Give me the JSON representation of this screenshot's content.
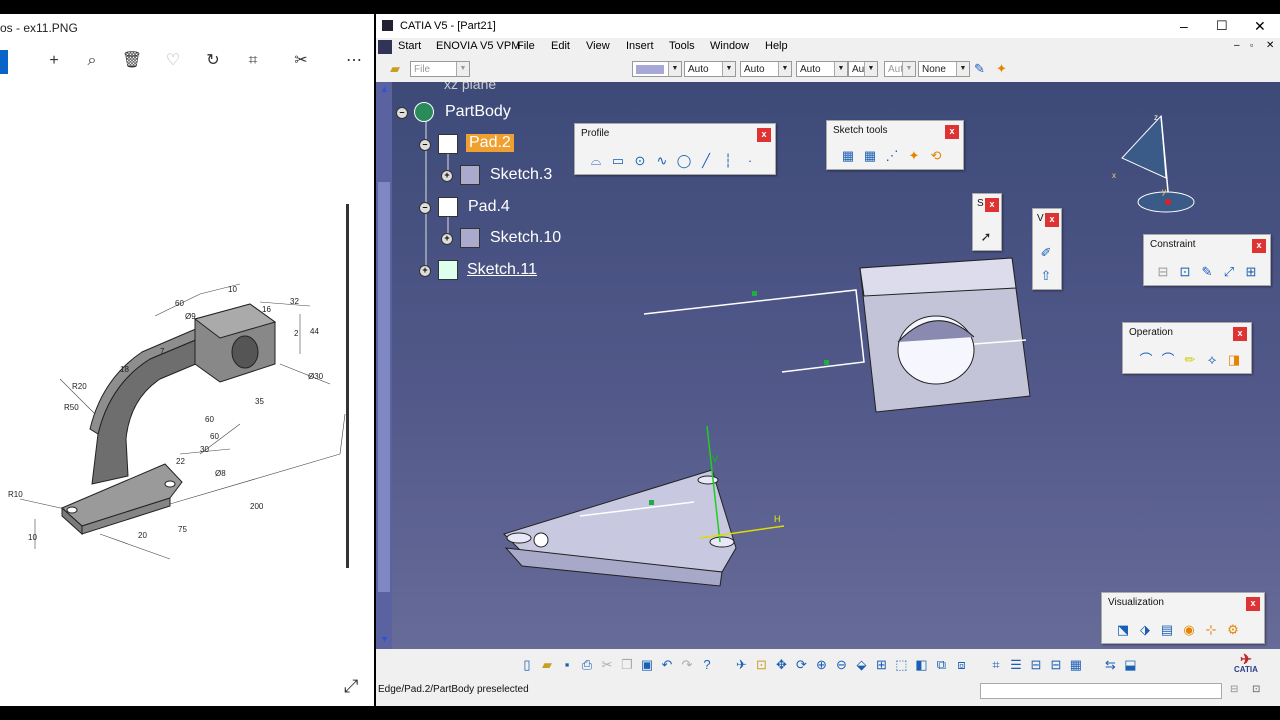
{
  "photos": {
    "title": "os - ex11.PNG",
    "toolbar": [
      {
        "name": "add-icon",
        "glyph": "+"
      },
      {
        "name": "zoom-icon",
        "glyph": "🔍"
      },
      {
        "name": "delete-icon",
        "glyph": "🗑"
      },
      {
        "name": "heart-icon",
        "glyph": "♡"
      },
      {
        "name": "rotate-icon",
        "glyph": "↻"
      },
      {
        "name": "crop-icon",
        "glyph": "⌗"
      },
      {
        "name": "edit-icon",
        "glyph": "✎"
      },
      {
        "name": "more-icon",
        "glyph": "⋯"
      }
    ],
    "drawing_labels": [
      "60",
      "Ø9",
      "10",
      "16",
      "32",
      "2",
      "44",
      "7",
      "Ø30",
      "R20",
      "18",
      "R50",
      "35",
      "60",
      "30",
      "22",
      "Ø8",
      "R10",
      "60",
      "200",
      "75",
      "20",
      "10"
    ]
  },
  "catia": {
    "title": "CATIA V5 - [Part21]",
    "menu": [
      "Start",
      "ENOVIA V5 VPM",
      "File",
      "Edit",
      "View",
      "Insert",
      "Tools",
      "Window",
      "Help"
    ],
    "toolbar_combos": [
      "File",
      "",
      "Auto",
      "Auto",
      "Auto",
      "Aut",
      "Aut",
      "None"
    ],
    "tree": {
      "partially_hidden": "xz plane",
      "items": [
        {
          "label": "PartBody",
          "selected": false
        },
        {
          "label": "Pad.2",
          "selected": true
        },
        {
          "label": "Sketch.3",
          "selected": false
        },
        {
          "label": "Pad.4",
          "selected": false
        },
        {
          "label": "Sketch.10",
          "selected": false
        },
        {
          "label": "Sketch.11",
          "selected": false
        }
      ]
    },
    "panels": {
      "profile": "Profile",
      "sketch_tools": "Sketch tools",
      "s_small": "S",
      "v_small": "V",
      "constraint": "Constraint",
      "operation": "Operation",
      "visualization": "Visualization"
    },
    "close_glyph": "x",
    "axis_labels": {
      "z": "z",
      "x": "x",
      "y": "y",
      "v": "V",
      "h": "H"
    },
    "status": "Edge/Pad.2/PartBody preselected",
    "brand": "CATIA",
    "accent": "#f0a030"
  }
}
